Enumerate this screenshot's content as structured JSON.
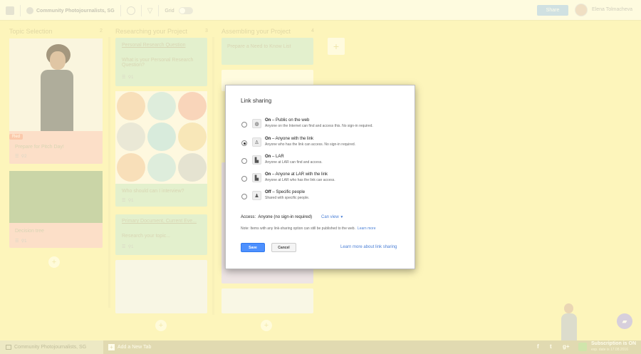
{
  "topbar": {
    "board_name": "Community Photojournalists, SG",
    "grid_label": "Grid",
    "share_label": "Share",
    "user_name": "Elena Tolmacheva"
  },
  "columns": [
    {
      "title": "Topic Selection",
      "count": "2"
    },
    {
      "title": "Researching your Project",
      "count": "3"
    },
    {
      "title": "Assembling your Project",
      "count": "4"
    }
  ],
  "cards": {
    "c1_tag": "Red",
    "c1_text": "Prepare for Pitch Day!",
    "c1_meta": "2",
    "c2_text": "Decision tree",
    "c2_meta": "1",
    "c3_link": "Personal Research Question",
    "c3_text": "What is your Personal Research Question?",
    "c3_meta": "1",
    "c4_text": "Who should can I interview?",
    "c4_meta": "1",
    "c5_link": "Primary Document, Current Eve...",
    "c5_text": "Research your topic...",
    "c5_meta": "1",
    "c6_text": "Prepare a Need to Know List"
  },
  "modal": {
    "title": "Link sharing",
    "options": [
      {
        "title": "On",
        "rest": " – Public on the web",
        "desc": "Anyone on the Internet can find and access this. No sign-in required."
      },
      {
        "title": "On",
        "rest": " – Anyone with the link",
        "desc": "Anyone who has the link can access. No sign-in required."
      },
      {
        "title": "On",
        "rest": " – LAR",
        "desc": "Anyone at LAR can find and access."
      },
      {
        "title": "On",
        "rest": " – Anyone at LAR with the link",
        "desc": "Anyone at LAR who has the link can access."
      },
      {
        "title": "Off",
        "rest": " – Specific people",
        "desc": "Shared with specific people."
      }
    ],
    "access_label": "Access:",
    "access_value": "Anyone (no sign-in required)",
    "access_dropdown": "Can view",
    "note": "Note: Items with any link-sharing option can still be published to the web.",
    "note_link": "Learn more",
    "save_label": "Save",
    "cancel_label": "Cancel",
    "learn_more_label": "Learn more about link sharing"
  },
  "bottombar": {
    "tab_label": "Community Photojournalists, SG",
    "add_tab_label": "Add a New Tab",
    "facebook": "f",
    "twitter": "t",
    "gplus": "g+",
    "sub_title": "Subscription is ON",
    "sub_date": "exp. date is 17.08.2016"
  },
  "colors": {
    "accent": "#4d90fe",
    "board_bg": "#fbf0a8",
    "green_card": "#cde8c8",
    "pink_card": "#f9c9c0",
    "purple_card": "#e0d3f2"
  }
}
